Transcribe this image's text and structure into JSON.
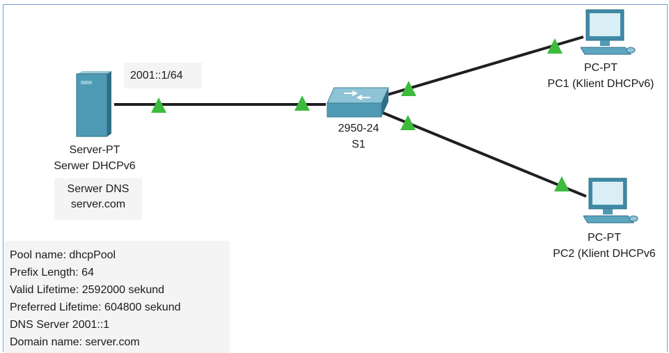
{
  "colors": {
    "link": "#1f1f1f",
    "status_up": "#3dbb3d",
    "frame": "#6f9fd8",
    "note_bg": "#f4f4f4"
  },
  "devices": {
    "server": {
      "icon": "server-icon",
      "model": "Server-PT",
      "name": "Serwer DHCPv6",
      "ip_label": "2001::1/64",
      "dns_line1": "Serwer DNS",
      "dns_line2": "server.com"
    },
    "switch": {
      "icon": "switch-icon",
      "model": "2950-24",
      "name": "S1"
    },
    "pc1": {
      "icon": "pc-icon",
      "model": "PC-PT",
      "name": "PC1 (Klient DHCPv6)"
    },
    "pc2": {
      "icon": "pc-icon",
      "model": "PC-PT",
      "name": "PC2 (Klient DHCPv6"
    }
  },
  "pool_info": [
    "Pool name: dhcpPool",
    "Prefix Length: 64",
    "Valid Lifetime: 2592000 sekund",
    "Preferred Lifetime: 604800 sekund",
    "DNS Server 2001::1",
    "Domain name: server.com"
  ]
}
